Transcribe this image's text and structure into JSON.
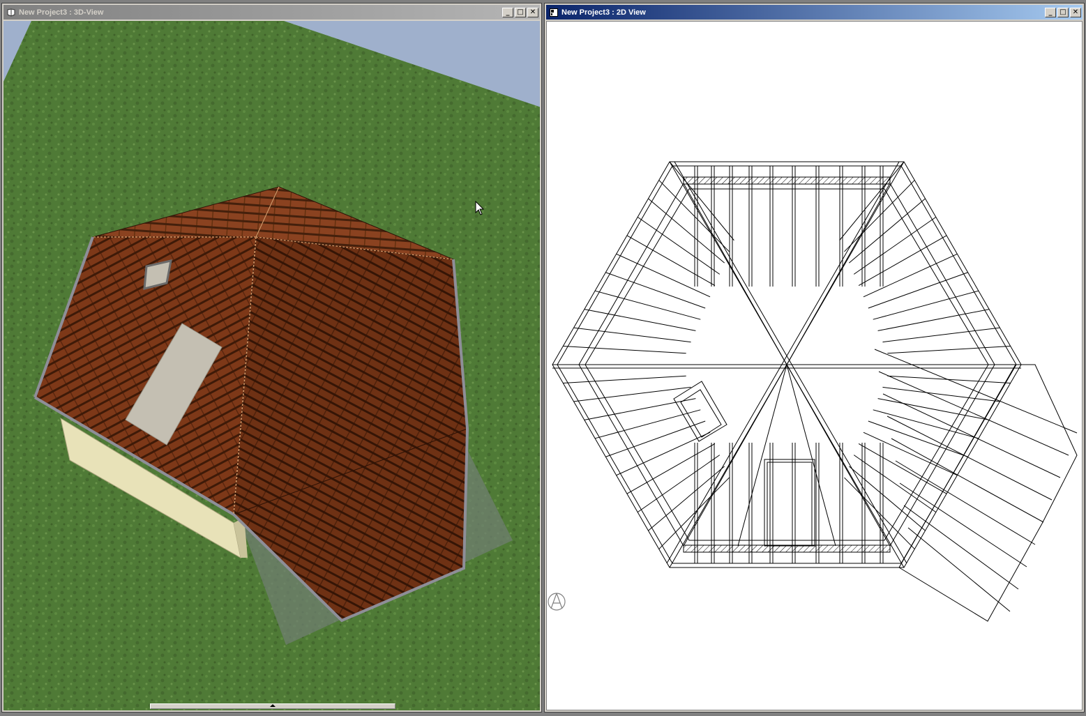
{
  "windows": {
    "view3d": {
      "title": "New Project3 : 3D-View",
      "icon": "3d-view-icon",
      "controls": {
        "minimize": "_",
        "maximize": "□",
        "close": "✕"
      }
    },
    "view2d": {
      "title": "New Project3 : 2D View",
      "icon": "2d-view-icon",
      "controls": {
        "minimize": "_",
        "maximize": "□",
        "close": "✕"
      }
    }
  },
  "colors": {
    "roof_tile": "#7a3516",
    "grass": "#4f7a36",
    "sky": "#9fb0cc",
    "wall": "#e8e2b8",
    "skylight": "#c4bfb2",
    "titlebar_active": "#0a246a"
  },
  "icons": [
    "mouse-cursor-icon",
    "north-arrow-icon"
  ]
}
